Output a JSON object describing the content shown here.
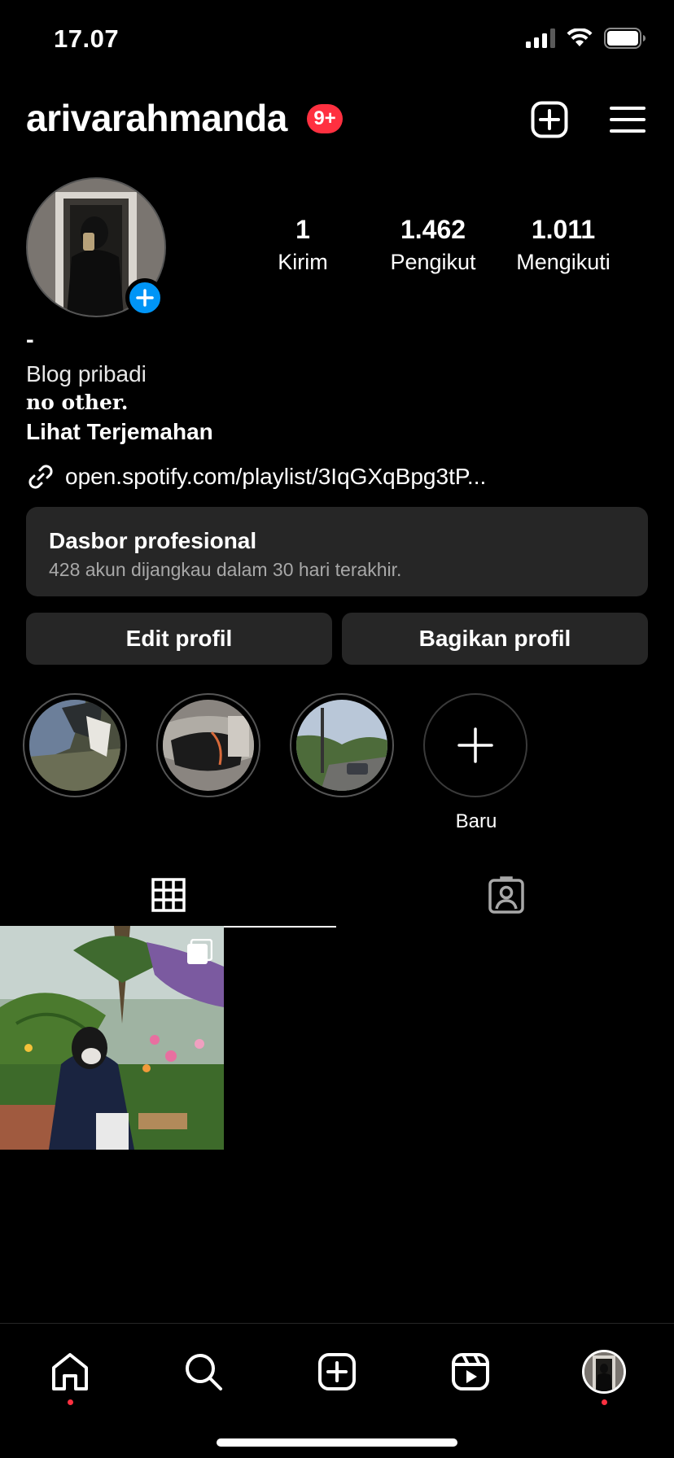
{
  "status_bar": {
    "time": "17.07",
    "signal_icon": "cellular-signal-icon",
    "wifi_icon": "wifi-icon",
    "battery_icon": "battery-icon"
  },
  "header": {
    "username": "arivarahmanda",
    "notification_badge": "9+",
    "create_icon": "plus-square-icon",
    "menu_icon": "hamburger-menu-icon"
  },
  "stats": [
    {
      "value": "1",
      "label": "Kirim"
    },
    {
      "value": "1.462",
      "label": "Pengikut"
    },
    {
      "value": "1.011",
      "label": "Mengikuti"
    }
  ],
  "bio": {
    "name": "-",
    "category": "Blog pribadi",
    "text": "no other.",
    "translate_label": "Lihat Terjemahan",
    "link": "open.spotify.com/playlist/3IqGXqBpg3tP..."
  },
  "dashboard": {
    "title": "Dasbor profesional",
    "subtitle": "428 akun dijangkau dalam 30 hari terakhir."
  },
  "actions": {
    "edit": "Edit profil",
    "share": "Bagikan profil"
  },
  "highlights": {
    "new_label": "Baru"
  },
  "tabs": [
    "grid-icon",
    "tagged-icon"
  ],
  "bottom_nav": [
    "home-icon",
    "search-icon",
    "create-icon",
    "reels-icon",
    "profile-avatar"
  ],
  "colors": {
    "accent_blue": "#0095f6",
    "badge_red": "#ff3040",
    "surface": "#262626",
    "muted_text": "#a8a8a8"
  }
}
